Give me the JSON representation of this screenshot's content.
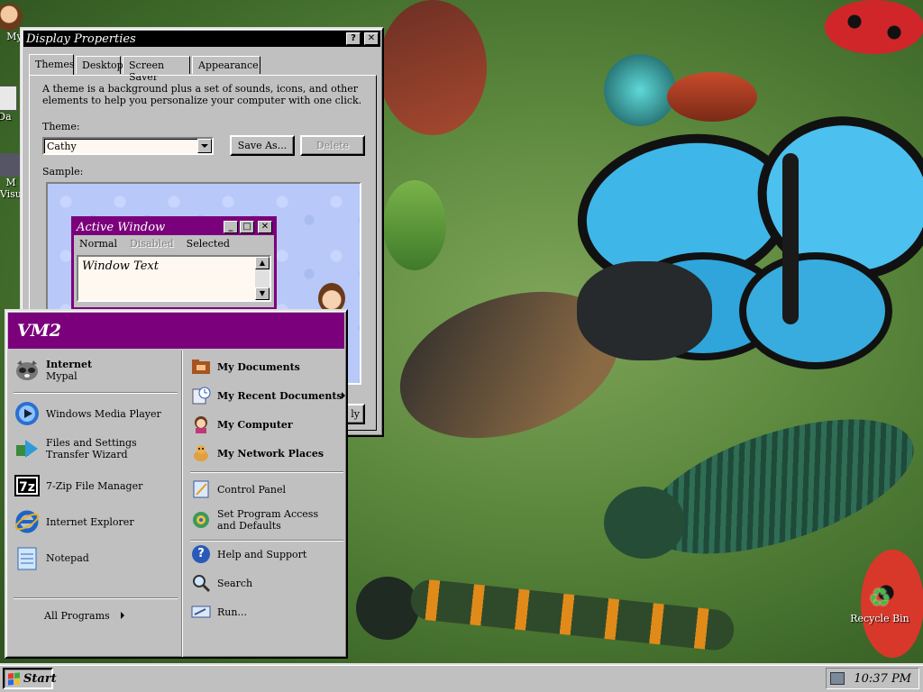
{
  "desktop": {
    "icons": [
      {
        "label": "My",
        "icon": "my-documents-icon"
      },
      {
        "label": "Da",
        "icon": "documents-icon"
      },
      {
        "label": "M",
        "icon": "media-icon"
      },
      {
        "label": "Visu",
        "icon": "visual-icon"
      },
      {
        "label": "Recycle Bin",
        "icon": "recycle-bin-icon"
      }
    ]
  },
  "display_properties": {
    "title": "Display Properties",
    "help_label": "?",
    "close_label": "✕",
    "tabs": [
      {
        "label": "Themes",
        "active": true
      },
      {
        "label": "Desktop",
        "active": false
      },
      {
        "label": "Screen Saver",
        "active": false
      },
      {
        "label": "Appearance",
        "active": false
      }
    ],
    "description": "A theme is a background plus a set of sounds, icons, and other elements to help you personalize your computer with one click.",
    "theme_label": "Theme:",
    "theme_value": "Cathy",
    "save_as_label": "Save As...",
    "delete_label": "Delete",
    "sample_label": "Sample:",
    "apply_label": "ly",
    "sample": {
      "window_title": "Active Window",
      "menu_normal": "Normal",
      "menu_disabled": "Disabled",
      "menu_selected": "Selected",
      "window_text": "Window Text"
    }
  },
  "start_menu": {
    "user": "VM2",
    "pinned": [
      {
        "title": "Internet",
        "subtitle": "Mypal",
        "icon": "raccoon-icon"
      }
    ],
    "recent": [
      {
        "label": "Windows Media Player",
        "icon": "media-player-icon"
      },
      {
        "label": "Files and Settings Transfer Wizard",
        "icon": "transfer-wizard-icon"
      },
      {
        "label": "7-Zip File Manager",
        "icon": "7zip-icon",
        "glyph": "7z"
      },
      {
        "label": "Internet Explorer",
        "icon": "internet-explorer-icon"
      },
      {
        "label": "Notepad",
        "icon": "notepad-icon"
      }
    ],
    "all_programs": "All Programs",
    "right_primary": [
      {
        "label": "My Documents",
        "icon": "my-documents-icon"
      },
      {
        "label": "My Recent Documents",
        "icon": "recent-documents-icon"
      },
      {
        "label": "My Computer",
        "icon": "my-computer-icon"
      },
      {
        "label": "My Network Places",
        "icon": "network-places-icon"
      }
    ],
    "right_secondary": [
      {
        "label": "Control Panel",
        "icon": "control-panel-icon"
      },
      {
        "label": "Set Program Access and Defaults",
        "icon": "program-access-icon"
      }
    ],
    "right_tertiary": [
      {
        "label": "Help and Support",
        "icon": "help-icon",
        "glyph": "?"
      },
      {
        "label": "Search",
        "icon": "search-icon"
      },
      {
        "label": "Run...",
        "icon": "run-icon"
      }
    ]
  },
  "taskbar": {
    "start_label": "Start",
    "clock": "10:37 PM"
  },
  "colors": {
    "accent_purple": "#7b007b",
    "sample_bg": "#b8c8f8",
    "titlebar": "#000000",
    "taskbar": "#c0c0c0"
  }
}
